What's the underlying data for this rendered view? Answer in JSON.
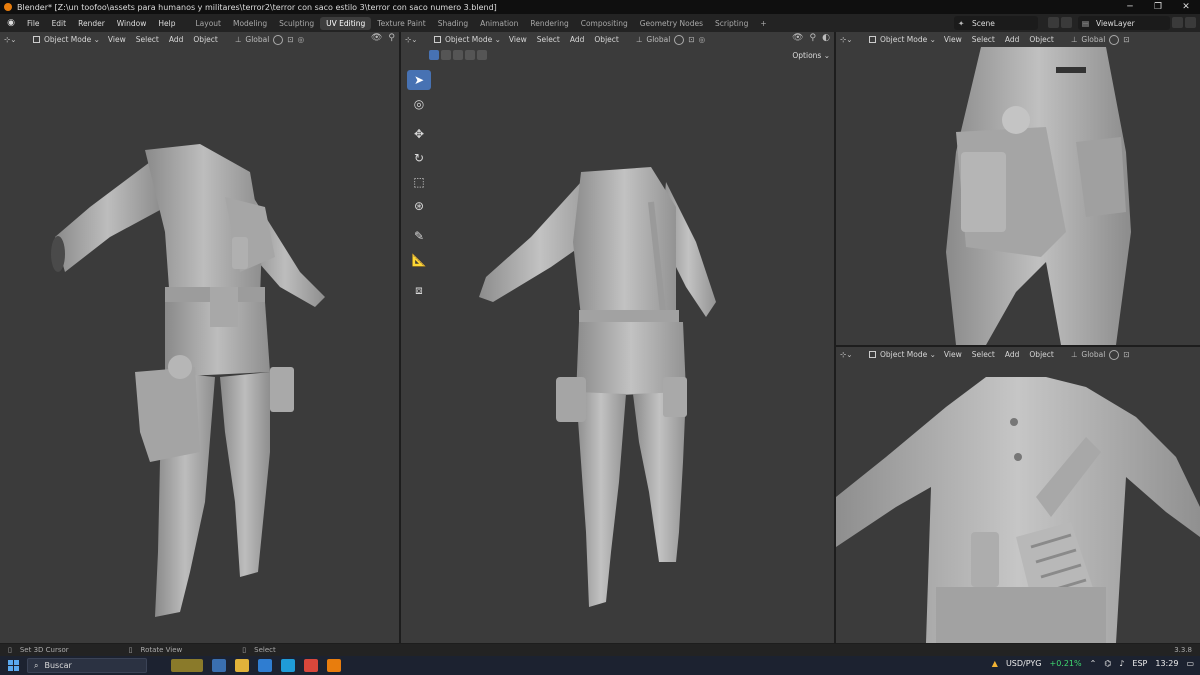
{
  "window": {
    "title": "Blender* [Z:\\un toofoo\\assets para humanos y militares\\terror2\\terror con saco estilo 3\\terror con saco numero 3.blend]",
    "minimize": "─",
    "maximize": "❐",
    "close": "✕"
  },
  "menu": [
    "File",
    "Edit",
    "Render",
    "Window",
    "Help"
  ],
  "workspaces": [
    "Layout",
    "Modeling",
    "Sculpting",
    "UV Editing",
    "Texture Paint",
    "Shading",
    "Animation",
    "Rendering",
    "Compositing",
    "Geometry Nodes",
    "Scripting",
    "+"
  ],
  "active_workspace": "UV Editing",
  "scene": "Scene",
  "view_layer": "ViewLayer",
  "viewport_header": {
    "mode": "Object Mode",
    "view": "View",
    "select": "Select",
    "add": "Add",
    "object": "Object",
    "orientation": "Global"
  },
  "center_view": {
    "options": "Options ⌄"
  },
  "tools": [
    "select-box",
    "cursor",
    "move",
    "rotate",
    "scale",
    "transform",
    "annotate",
    "measure",
    "add-cube"
  ],
  "status": {
    "left": "Set 3D Cursor",
    "middle": "Rotate View",
    "right": "Select",
    "version": "3.3.8"
  },
  "taskbar": {
    "search": "Buscar",
    "ticker": "USD/PYG",
    "change": "+0.21%",
    "lang": "ESP",
    "time": "13:29"
  }
}
